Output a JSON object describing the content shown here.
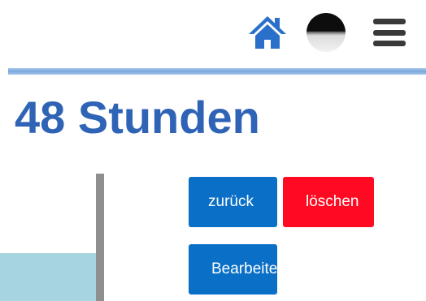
{
  "header": {
    "home_icon": "home-icon",
    "theme_icon": "theme-toggle-icon",
    "menu_icon": "hamburger-menu-icon"
  },
  "page": {
    "title": "48 Stunden"
  },
  "actions": {
    "back_label": "zurück",
    "delete_label": "löschen",
    "edit_label": "Bearbeiten"
  },
  "colors": {
    "title": "#2f63b6",
    "home_icon": "#2a6fc9",
    "divider": "#7aa6dc",
    "button_primary": "#0a6fc6",
    "button_danger": "#ff0a22",
    "chart_fill": "#a6d5df",
    "chart_axis": "#8f8f8f"
  }
}
